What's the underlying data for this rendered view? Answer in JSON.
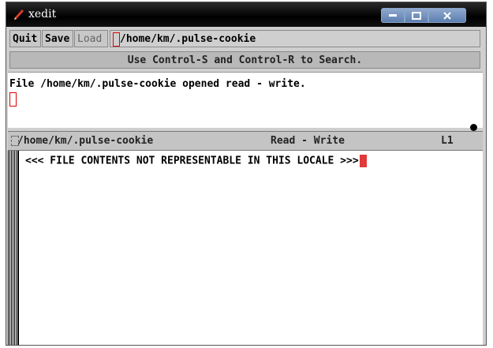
{
  "window": {
    "title": "xedit",
    "icon": "pen-icon",
    "controls": [
      "minimize-icon",
      "maximize-icon",
      "close-icon"
    ]
  },
  "commands": {
    "quit_label": "Quit",
    "save_label": "Save",
    "load_label": "Load",
    "filename_value": "/home/km/.pulse-cookie"
  },
  "labelbar": {
    "text": "Use Control-S and Control-R to Search."
  },
  "message": {
    "text": "File /home/km/.pulse-cookie opened read - write."
  },
  "status": {
    "path": "/home/km/.pulse-cookie",
    "mode": "Read - Write",
    "line": "L1"
  },
  "editor": {
    "content": "<<< FILE CONTENTS NOT REPRESENTABLE IN THIS LOCALE >>>"
  },
  "colors": {
    "cursor": "#e03a3a",
    "titlebar": "#000000",
    "window_controls": "#6d8dbd"
  }
}
